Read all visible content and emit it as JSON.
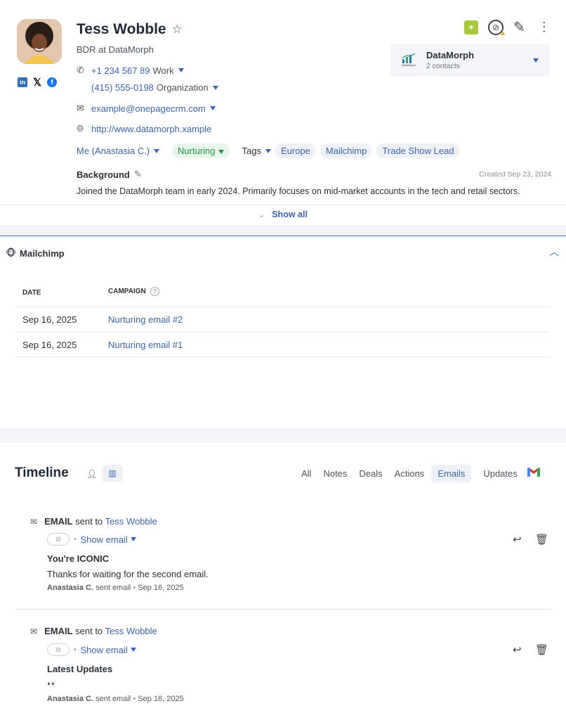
{
  "contact": {
    "name": "Tess Wobble",
    "title": "BDR at DataMorph",
    "phone1": "+1 234 567 89",
    "phone1_type": "Work",
    "phone2": "(415) 555-0198",
    "phone2_type": "Organization",
    "email": "example@onepagecrm.com",
    "website": "http://www.datamorph.xample",
    "owner": "Me (Anastasia C.)",
    "status": "Nurturing",
    "tags_label": "Tags",
    "tags": [
      "Europe",
      "Mailchimp",
      "Trade Show Lead"
    ],
    "background_label": "Background",
    "created": "Created Sep 23, 2024",
    "background_text": "Joined the DataMorph team in early 2024. Primarily focuses on mid-market accounts in the tech and retail sectors.",
    "show_all": "Show all"
  },
  "company": {
    "name": "DataMorph",
    "contacts": "2 contacts",
    "logo_text": "DataMorph"
  },
  "mailchimp": {
    "title": "Mailchimp",
    "col_date": "DATE",
    "col_campaign": "CAMPAIGN",
    "rows": [
      {
        "date": "Sep 16, 2025",
        "campaign": "Nurturing email #2"
      },
      {
        "date": "Sep 16, 2025",
        "campaign": "Nurturing email #1"
      }
    ]
  },
  "timeline": {
    "title": "Timeline",
    "tabs": [
      "All",
      "Notes",
      "Deals",
      "Actions",
      "Emails",
      "Updates"
    ],
    "active_tab": "Emails",
    "events": [
      {
        "type": "EMAIL",
        "sent_to": "sent to",
        "recipient": "Tess Wobble",
        "show_email": "Show email",
        "subject": "You're ICONIC",
        "body": "Thanks for waiting for the second email.",
        "author": "Anastasia C.",
        "action": "sent email",
        "date": "Sep 16, 2025"
      },
      {
        "type": "EMAIL",
        "sent_to": "sent to",
        "recipient": "Tess Wobble",
        "show_email": "Show email",
        "subject": "Latest Updates",
        "body": "👀",
        "author": "Anastasia C.",
        "action": "sent email",
        "date": "Sep 16, 2025"
      }
    ]
  },
  "colors": {
    "link": "#3a64b5",
    "status_green": "#1a9b46",
    "gmail_red": "#d93025"
  }
}
